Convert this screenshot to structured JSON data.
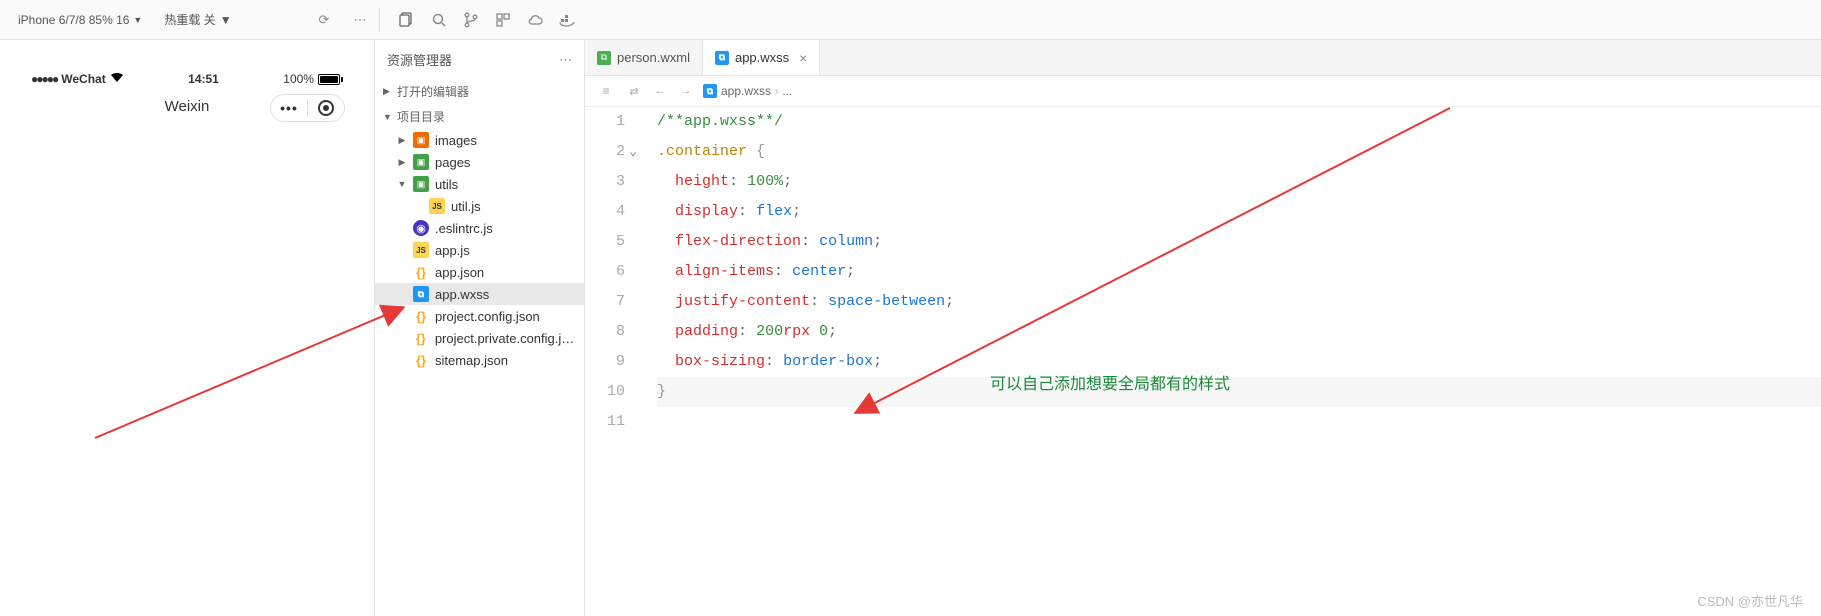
{
  "toolbar": {
    "device": "iPhone 6/7/8 85% 16",
    "hot_reload": "热重载 关"
  },
  "simulator": {
    "status_left": "WeChat",
    "time": "14:51",
    "battery_pct": "100%",
    "page_title": "Weixin"
  },
  "explorer": {
    "title": "资源管理器",
    "sections": {
      "editors": "打开的编辑器",
      "project": "项目目录"
    },
    "tree": {
      "images": "images",
      "pages": "pages",
      "utils": "utils",
      "utiljs": "util.js",
      "eslint": ".eslintrc.js",
      "appjs": "app.js",
      "appjson": "app.json",
      "appwxss": "app.wxss",
      "projcfg": "project.config.json",
      "projpriv": "project.private.config.js...",
      "sitemap": "sitemap.json"
    }
  },
  "tabs": {
    "person": "person.wxml",
    "appwxss": "app.wxss"
  },
  "breadcrumb": {
    "file": "app.wxss"
  },
  "code": {
    "l1": "/**app.wxss**/",
    "l2_sel": ".container",
    "l3_p": "height",
    "l3_v": "100%",
    "l4_p": "display",
    "l4_v": "flex",
    "l5_p": "flex-direction",
    "l5_v": "column",
    "l6_p": "align-items",
    "l6_v": "center",
    "l7_p": "justify-content",
    "l7_v": "space-between",
    "l8_p": "padding",
    "l8_n": "200",
    "l8_u": "rpx",
    "l8_n2": "0",
    "l9_p": "box-sizing",
    "l9_v": "border-box"
  },
  "annotation": "可以自己添加想要全局都有的样式",
  "watermark": "CSDN @亦世凡华"
}
